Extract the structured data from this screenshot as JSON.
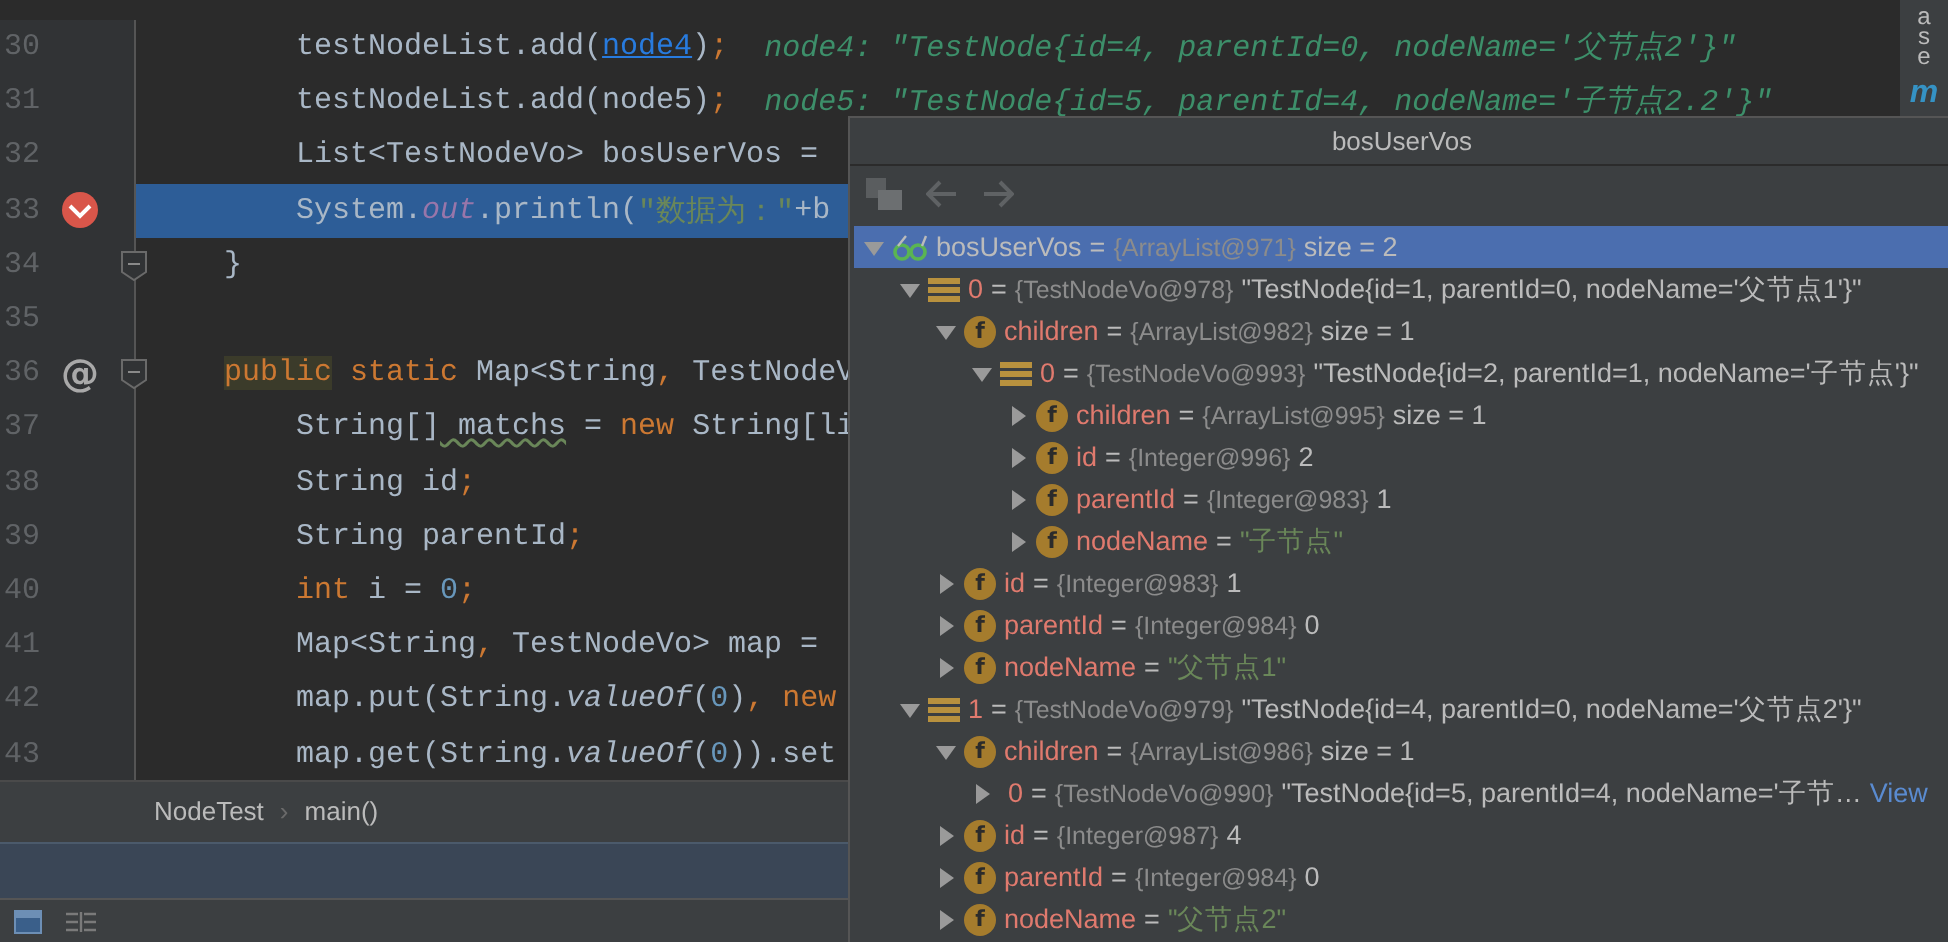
{
  "editor": {
    "lines": [
      {
        "number": "30",
        "kind": "statement",
        "tokens": [
          {
            "kind": "plain",
            "text": "testNodeList.add("
          },
          {
            "kind": "link",
            "text": "node4"
          },
          {
            "kind": "plain",
            "text": ")"
          },
          {
            "kind": "punct",
            "text": ";"
          },
          {
            "kind": "debug",
            "text": "node4: \"TestNode{id=4, parentId=0, nodeName='父节点2'}\""
          }
        ]
      },
      {
        "number": "31",
        "kind": "statement",
        "tokens": [
          {
            "kind": "plain",
            "text": "testNodeList.add(node5)"
          },
          {
            "kind": "punct",
            "text": ";"
          },
          {
            "kind": "debug",
            "text": "node5: \"TestNode{id=5, parentId=4, nodeName='子节点2.2'}\""
          }
        ]
      },
      {
        "number": "32",
        "kind": "statement",
        "tokens": [
          {
            "kind": "plain",
            "text": "List<TestNodeVo> bosUserVos ="
          }
        ]
      },
      {
        "number": "33",
        "kind": "statement",
        "current": true,
        "breakpoint": true,
        "tokens": [
          {
            "kind": "plain",
            "text": "System."
          },
          {
            "kind": "static",
            "text": "out"
          },
          {
            "kind": "plain",
            "text": ".println("
          },
          {
            "kind": "string",
            "text": "\"数据为：\""
          },
          {
            "kind": "plain",
            "text": "+b"
          }
        ]
      },
      {
        "number": "34",
        "kind": "member",
        "fold": true,
        "tokens": [
          {
            "kind": "plain",
            "text": "}"
          }
        ]
      },
      {
        "number": "35",
        "kind": "blank"
      },
      {
        "number": "36",
        "kind": "member",
        "fold": true,
        "annotation": "@",
        "tokens": [
          {
            "kind": "keyword-marked",
            "text": "public"
          },
          {
            "kind": "keyword",
            "text": " static"
          },
          {
            "kind": "plain",
            "text": " Map<String"
          },
          {
            "kind": "punct",
            "text": ","
          },
          {
            "kind": "plain",
            "text": " TestNodeV"
          }
        ]
      },
      {
        "number": "37",
        "kind": "statement",
        "tokens": [
          {
            "kind": "plain",
            "text": "String[]"
          },
          {
            "kind": "warn",
            "text": " matchs"
          },
          {
            "kind": "plain",
            "text": " ="
          },
          {
            "kind": "keyword",
            "text": " new"
          },
          {
            "kind": "plain",
            "text": " String[li"
          }
        ]
      },
      {
        "number": "38",
        "kind": "statement",
        "tokens": [
          {
            "kind": "plain",
            "text": "String id"
          },
          {
            "kind": "punct",
            "text": ";"
          }
        ]
      },
      {
        "number": "39",
        "kind": "statement",
        "tokens": [
          {
            "kind": "plain",
            "text": "String parentId"
          },
          {
            "kind": "punct",
            "text": ";"
          }
        ]
      },
      {
        "number": "40",
        "kind": "statement",
        "tokens": [
          {
            "kind": "keyword",
            "text": "int"
          },
          {
            "kind": "plain",
            "text": " i ="
          },
          {
            "kind": "number",
            "text": " 0"
          },
          {
            "kind": "punct",
            "text": ";"
          }
        ]
      },
      {
        "number": "41",
        "kind": "statement",
        "tokens": [
          {
            "kind": "plain",
            "text": "Map<String"
          },
          {
            "kind": "punct",
            "text": ","
          },
          {
            "kind": "plain",
            "text": " TestNodeVo> map ="
          }
        ]
      },
      {
        "number": "42",
        "kind": "statement",
        "tokens": [
          {
            "kind": "plain",
            "text": "map.put(String."
          },
          {
            "kind": "italic",
            "text": "valueOf"
          },
          {
            "kind": "plain",
            "text": "("
          },
          {
            "kind": "number",
            "text": "0"
          },
          {
            "kind": "plain",
            "text": ")"
          },
          {
            "kind": "punct",
            "text": ","
          },
          {
            "kind": "keyword",
            "text": " new"
          }
        ]
      },
      {
        "number": "43",
        "kind": "statement",
        "tokens": [
          {
            "kind": "plain",
            "text": "map.get(String."
          },
          {
            "kind": "italic",
            "text": "valueOf"
          },
          {
            "kind": "plain",
            "text": "("
          },
          {
            "kind": "number",
            "text": "0"
          },
          {
            "kind": "plain",
            "text": ")).set"
          }
        ]
      }
    ]
  },
  "right_strip": {
    "label": "ase",
    "icon_text": "m"
  },
  "breadcrumbs": {
    "items": [
      "NodeTest",
      "main()"
    ],
    "separator": "›"
  },
  "popup": {
    "title": "bosUserVos",
    "tree": [
      {
        "kind": "watch",
        "op": "=",
        "name": "bosUserVos",
        "type": "{ArrayList@971}",
        "value": "size = 2",
        "expanded": true,
        "selected": true,
        "children": [
          {
            "kind": "element",
            "op": "=",
            "name": "0",
            "type": "{TestNodeVo@978}",
            "value": "\"TestNode{id=1, parentId=0, nodeName='父节点1'}\"",
            "expanded": true,
            "selected": false,
            "children": [
              {
                "kind": "field",
                "badge": "f",
                "op": "=",
                "name": "children",
                "type": "{ArrayList@982}",
                "value": "size = 1",
                "expanded": true,
                "selected": false,
                "children": [
                  {
                    "kind": "element",
                    "op": "=",
                    "name": "0",
                    "type": "{TestNodeVo@993}",
                    "value": "\"TestNode{id=2, parentId=1, nodeName='子节点'}\"",
                    "expanded": true,
                    "selected": false,
                    "children": [
                      {
                        "kind": "field",
                        "badge": "f",
                        "op": "=",
                        "name": "children",
                        "type": "{ArrayList@995}",
                        "value": "size = 1",
                        "expanded": false,
                        "selected": false
                      },
                      {
                        "kind": "field",
                        "badge": "f",
                        "op": "=",
                        "name": "id",
                        "type": "{Integer@996}",
                        "value": "2",
                        "expanded": false,
                        "selected": false
                      },
                      {
                        "kind": "field",
                        "badge": "f",
                        "op": "=",
                        "name": "parentId",
                        "type": "{Integer@983}",
                        "value": "1",
                        "expanded": false,
                        "selected": false
                      },
                      {
                        "kind": "string-field",
                        "badge": "f",
                        "op": "=",
                        "name": "nodeName",
                        "value": "\"子节点\"",
                        "expanded": false,
                        "selected": false
                      }
                    ]
                  }
                ]
              },
              {
                "kind": "field",
                "badge": "f",
                "op": "=",
                "name": "id",
                "type": "{Integer@983}",
                "value": "1",
                "expanded": false,
                "selected": false
              },
              {
                "kind": "field",
                "badge": "f",
                "op": "=",
                "name": "parentId",
                "type": "{Integer@984}",
                "value": "0",
                "expanded": false,
                "selected": false
              },
              {
                "kind": "string-field",
                "badge": "f",
                "op": "=",
                "name": "nodeName",
                "value": "\"父节点1\"",
                "expanded": false,
                "selected": false
              }
            ]
          },
          {
            "kind": "element",
            "op": "=",
            "name": "1",
            "type": "{TestNodeVo@979}",
            "value": "\"TestNode{id=4, parentId=0, nodeName='父节点2'}\"",
            "expanded": true,
            "selected": false,
            "children": [
              {
                "kind": "field",
                "badge": "f",
                "op": "=",
                "name": "children",
                "type": "{ArrayList@986}",
                "value": "size = 1",
                "expanded": true,
                "selected": false,
                "children": [
                  {
                    "kind": "element",
                    "op": "=",
                    "name": "0",
                    "type": "{TestNodeVo@990}",
                    "value": "\"TestNode{id=5, parentId=4, nodeName='子节…",
                    "link": "View",
                    "expanded": false,
                    "selected": false
                  }
                ]
              },
              {
                "kind": "field",
                "badge": "f",
                "op": "=",
                "name": "id",
                "type": "{Integer@987}",
                "value": "4",
                "expanded": false,
                "selected": false
              },
              {
                "kind": "field",
                "badge": "f",
                "op": "=",
                "name": "parentId",
                "type": "{Integer@984}",
                "value": "0",
                "expanded": false,
                "selected": false
              },
              {
                "kind": "string-field",
                "badge": "f",
                "op": "=",
                "name": "nodeName",
                "value": "\"父节点2\"",
                "expanded": false,
                "selected": false
              }
            ]
          }
        ]
      }
    ]
  }
}
